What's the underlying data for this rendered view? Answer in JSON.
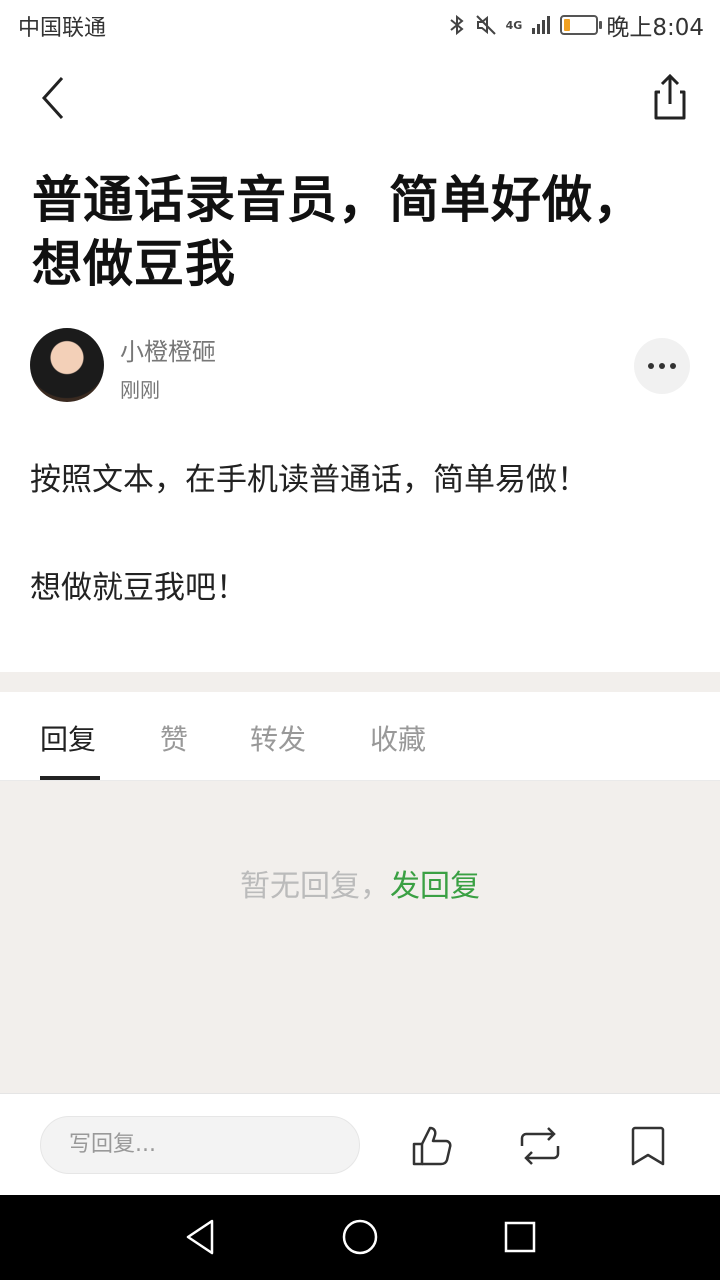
{
  "status": {
    "carrier": "中国联通",
    "network": "4G",
    "time": "晚上8:04",
    "battery_level": 0.2
  },
  "post": {
    "title": "普通话录音员，简单好做，想做豆我",
    "author": "小橙橙砸",
    "time": "刚刚",
    "paragraphs": [
      "按照文本，在手机读普通话，简单易做！",
      "想做就豆我吧！"
    ]
  },
  "tabs": [
    {
      "label": "回复",
      "active": true
    },
    {
      "label": "赞"
    },
    {
      "label": "转发"
    },
    {
      "label": "收藏"
    }
  ],
  "replies": {
    "empty_text": "暂无回复，",
    "empty_link": "发回复"
  },
  "bottom_bar": {
    "input_placeholder": "写回复..."
  },
  "colors": {
    "accent_green": "#3aa043",
    "band_bg": "#f2efec"
  }
}
